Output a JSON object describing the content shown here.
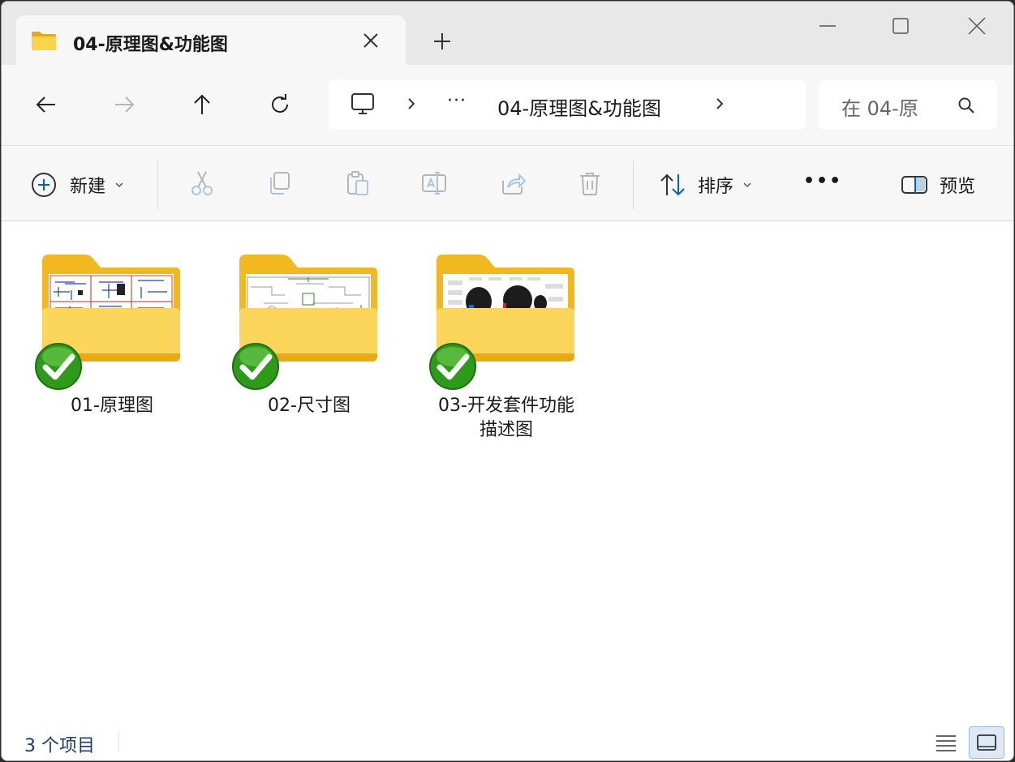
{
  "window": {
    "tab_title": "04-原理图&功能图"
  },
  "address": {
    "more": "···",
    "path": "04-原理图&功能图"
  },
  "search": {
    "placeholder": "在 04-原"
  },
  "commands": {
    "new_label": "新建",
    "sort_label": "排序",
    "more_label": "•••",
    "preview_label": "预览"
  },
  "items": [
    {
      "name": "01-原理图",
      "thumbnail": "schematic"
    },
    {
      "name": "02-尺寸图",
      "thumbnail": "dimension-drawing"
    },
    {
      "name": "03-开发套件功能\n描述图",
      "thumbnail": "function-diagram"
    }
  ],
  "status": {
    "count_text": "3 个项目"
  },
  "colors": {
    "folder_back": "#f2b820",
    "folder_front": "#fcd65a",
    "check_green": "#2e9a1a",
    "accent": "#005fb8"
  }
}
